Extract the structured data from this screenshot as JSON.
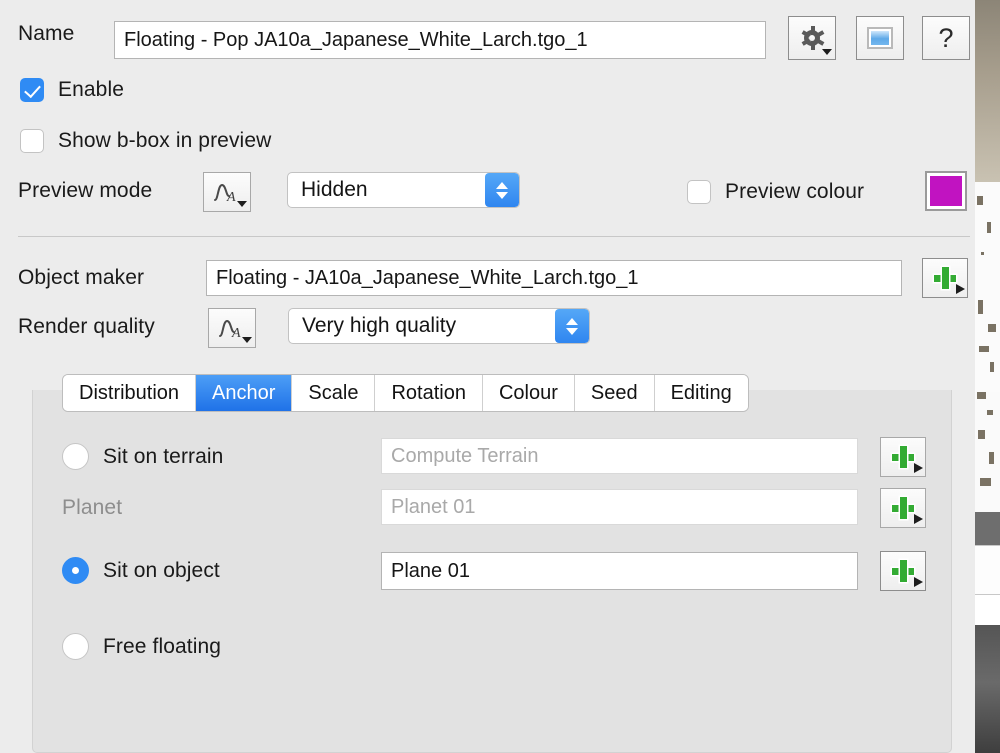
{
  "header": {
    "name_label": "Name",
    "name_value": "Floating - Pop JA10a_Japanese_White_Larch.tgo_1",
    "gear_icon": "gear-icon",
    "preview_icon": "preview-window-icon",
    "help_label": "?"
  },
  "enable": {
    "label": "Enable",
    "checked": true
  },
  "show_bbox": {
    "label": "Show b-box in preview",
    "checked": false
  },
  "preview_mode": {
    "label": "Preview mode",
    "function_icon": "function-curve-icon",
    "value": "Hidden",
    "options": [
      "Hidden"
    ]
  },
  "preview_colour": {
    "label": "Preview colour",
    "checked": false,
    "colour": "#c113c1"
  },
  "object_maker": {
    "label": "Object maker",
    "value": "Floating - JA10a_Japanese_White_Larch.tgo_1",
    "add_icon": "green-plus-icon"
  },
  "render_quality": {
    "label": "Render quality",
    "function_icon": "function-curve-icon",
    "value": "Very high quality",
    "options": [
      "Very high quality"
    ]
  },
  "tabs": [
    {
      "label": "Distribution",
      "active": false
    },
    {
      "label": "Anchor",
      "active": true
    },
    {
      "label": "Scale",
      "active": false
    },
    {
      "label": "Rotation",
      "active": false
    },
    {
      "label": "Colour",
      "active": false
    },
    {
      "label": "Seed",
      "active": false
    },
    {
      "label": "Editing",
      "active": false
    }
  ],
  "anchor": {
    "sit_on_terrain": {
      "label": "Sit on terrain",
      "selected": false,
      "field_value": "Compute Terrain",
      "field_disabled": true,
      "add_icon": "green-plus-icon"
    },
    "planet": {
      "label": "Planet",
      "label_disabled": true,
      "field_value": "Planet 01",
      "field_disabled": true,
      "add_icon": "green-plus-icon"
    },
    "sit_on_object": {
      "label": "Sit on object",
      "selected": true,
      "field_value": "Plane 01",
      "field_disabled": false,
      "add_icon": "green-plus-icon"
    },
    "free_floating": {
      "label": "Free floating",
      "selected": false
    }
  },
  "colors": {
    "accent_blue": "#2f8bf4",
    "panel_bg": "#ececec",
    "tab_panel_bg": "#e2e2e2",
    "plus_green": "#33ab33",
    "preview_magenta": "#c113c1"
  }
}
